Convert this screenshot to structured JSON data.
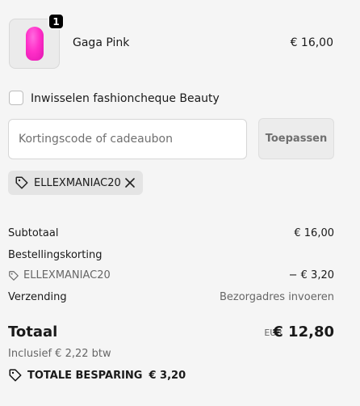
{
  "product": {
    "name": "Gaga Pink",
    "price": "€ 16,00",
    "quantity": "1",
    "swatch_color": "#ff2fc8"
  },
  "fashioncheque": {
    "label": "Inwisselen fashioncheque Beauty",
    "checked": false
  },
  "discount": {
    "placeholder": "Kortingscode of cadeaubon",
    "value": "",
    "apply_label": "Toepassen",
    "applied_code": "ELLEXMANIAC20"
  },
  "summary": {
    "subtotal_label": "Subtotaal",
    "subtotal_value": "€ 16,00",
    "order_discount_label": "Bestellingskorting",
    "order_discount_code": "ELLEXMANIAC20",
    "order_discount_value": "− € 3,20",
    "shipping_label": "Verzending",
    "shipping_value": "Bezorgadres invoeren",
    "total_label": "Totaal",
    "total_currency": "EUR",
    "total_value": "€ 12,80",
    "tax_note": "Inclusief € 2,22 btw",
    "savings_label": "TOTALE BESPARING",
    "savings_value": "€ 3,20"
  },
  "icons": {
    "tag": "tag-icon",
    "close": "close-icon"
  }
}
